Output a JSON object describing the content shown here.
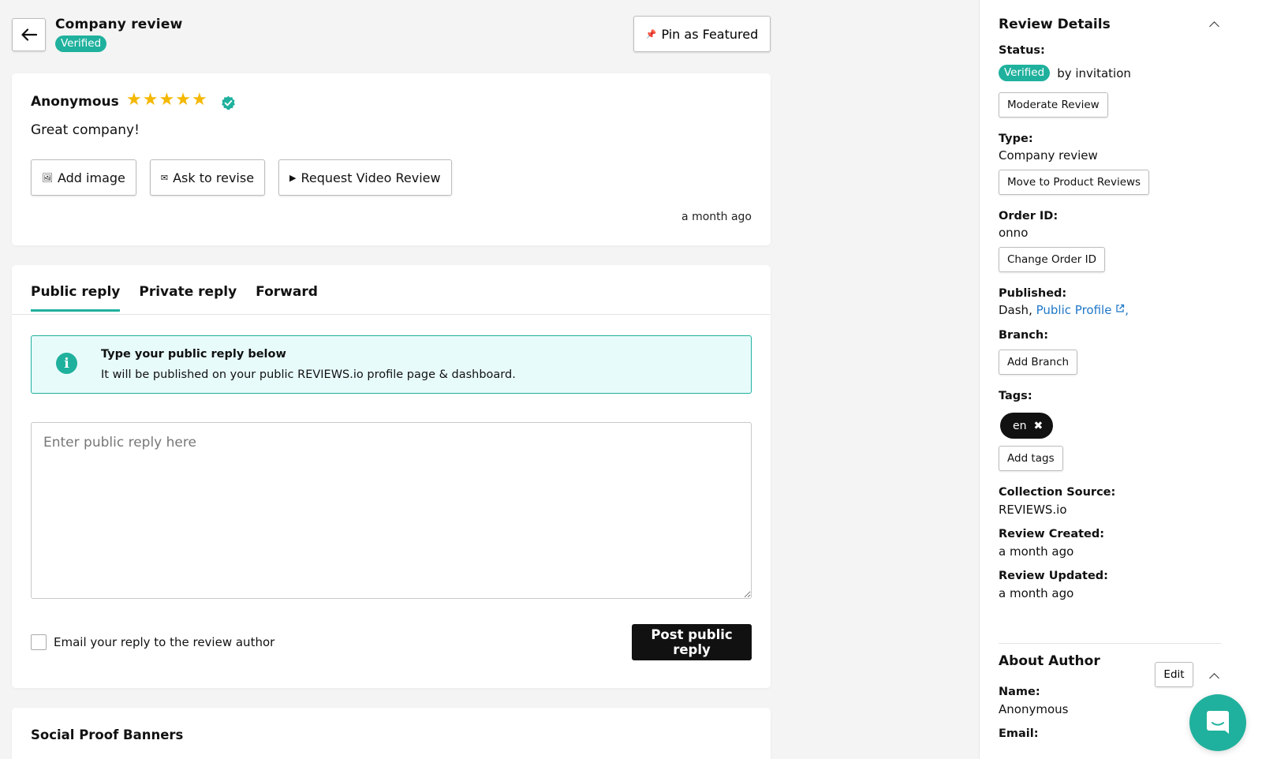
{
  "header": {
    "title": "Company review",
    "badge": "Verified",
    "pin_label": "Pin as Featured"
  },
  "review": {
    "author": "Anonymous",
    "rating": 5,
    "text": "Great company!",
    "buttons": {
      "add_image": "Add image",
      "ask_revise": "Ask to revise",
      "request_video": "Request Video Review"
    },
    "time": "a month ago"
  },
  "reply": {
    "tabs": [
      "Public reply",
      "Private reply",
      "Forward"
    ],
    "info_title": "Type your public reply below",
    "info_body": "It will be published on your public REVIEWS.io profile page & dashboard.",
    "placeholder": "Enter public reply here",
    "email_label": "Email your reply to the review author",
    "post_label": "Post public reply"
  },
  "social_proof": {
    "title": "Social Proof Banners"
  },
  "sidebar": {
    "heading": "Review Details",
    "status_label": "Status:",
    "status_badge": "Verified",
    "status_suffix": "by invitation",
    "moderate_label": "Moderate Review",
    "type_label": "Type:",
    "type_value": "Company review",
    "move_label": "Move to Product Reviews",
    "order_label": "Order ID:",
    "order_value": "onno",
    "change_order_label": "Change Order ID",
    "published_label": "Published:",
    "published_prefix": "Dash,",
    "published_link": "Public Profile",
    "published_suffix": ",",
    "branch_label": "Branch:",
    "add_branch_label": "Add Branch",
    "tags_label": "Tags:",
    "tags": [
      "en"
    ],
    "add_tags_label": "Add tags",
    "source_label": "Collection Source:",
    "source_value": "REVIEWS.io",
    "created_label": "Review Created:",
    "created_value": "a month ago",
    "updated_label": "Review Updated:",
    "updated_value": "a month ago",
    "author_heading": "About Author",
    "edit_label": "Edit",
    "name_label": "Name:",
    "name_value": "Anonymous",
    "email_label": "Email:"
  },
  "colors": {
    "accent": "#1fb19d",
    "info_bg": "#e8fbfb",
    "star": "#f5b800",
    "link": "#1f78c8",
    "primary_button": "#111111"
  },
  "icons": [
    "back-arrow-icon",
    "pin-icon",
    "star-icon",
    "verified-check-icon",
    "image-icon",
    "envelope-icon",
    "play-icon",
    "info-icon",
    "chevron-up-icon",
    "external-link-icon",
    "close-icon",
    "chat-icon"
  ]
}
